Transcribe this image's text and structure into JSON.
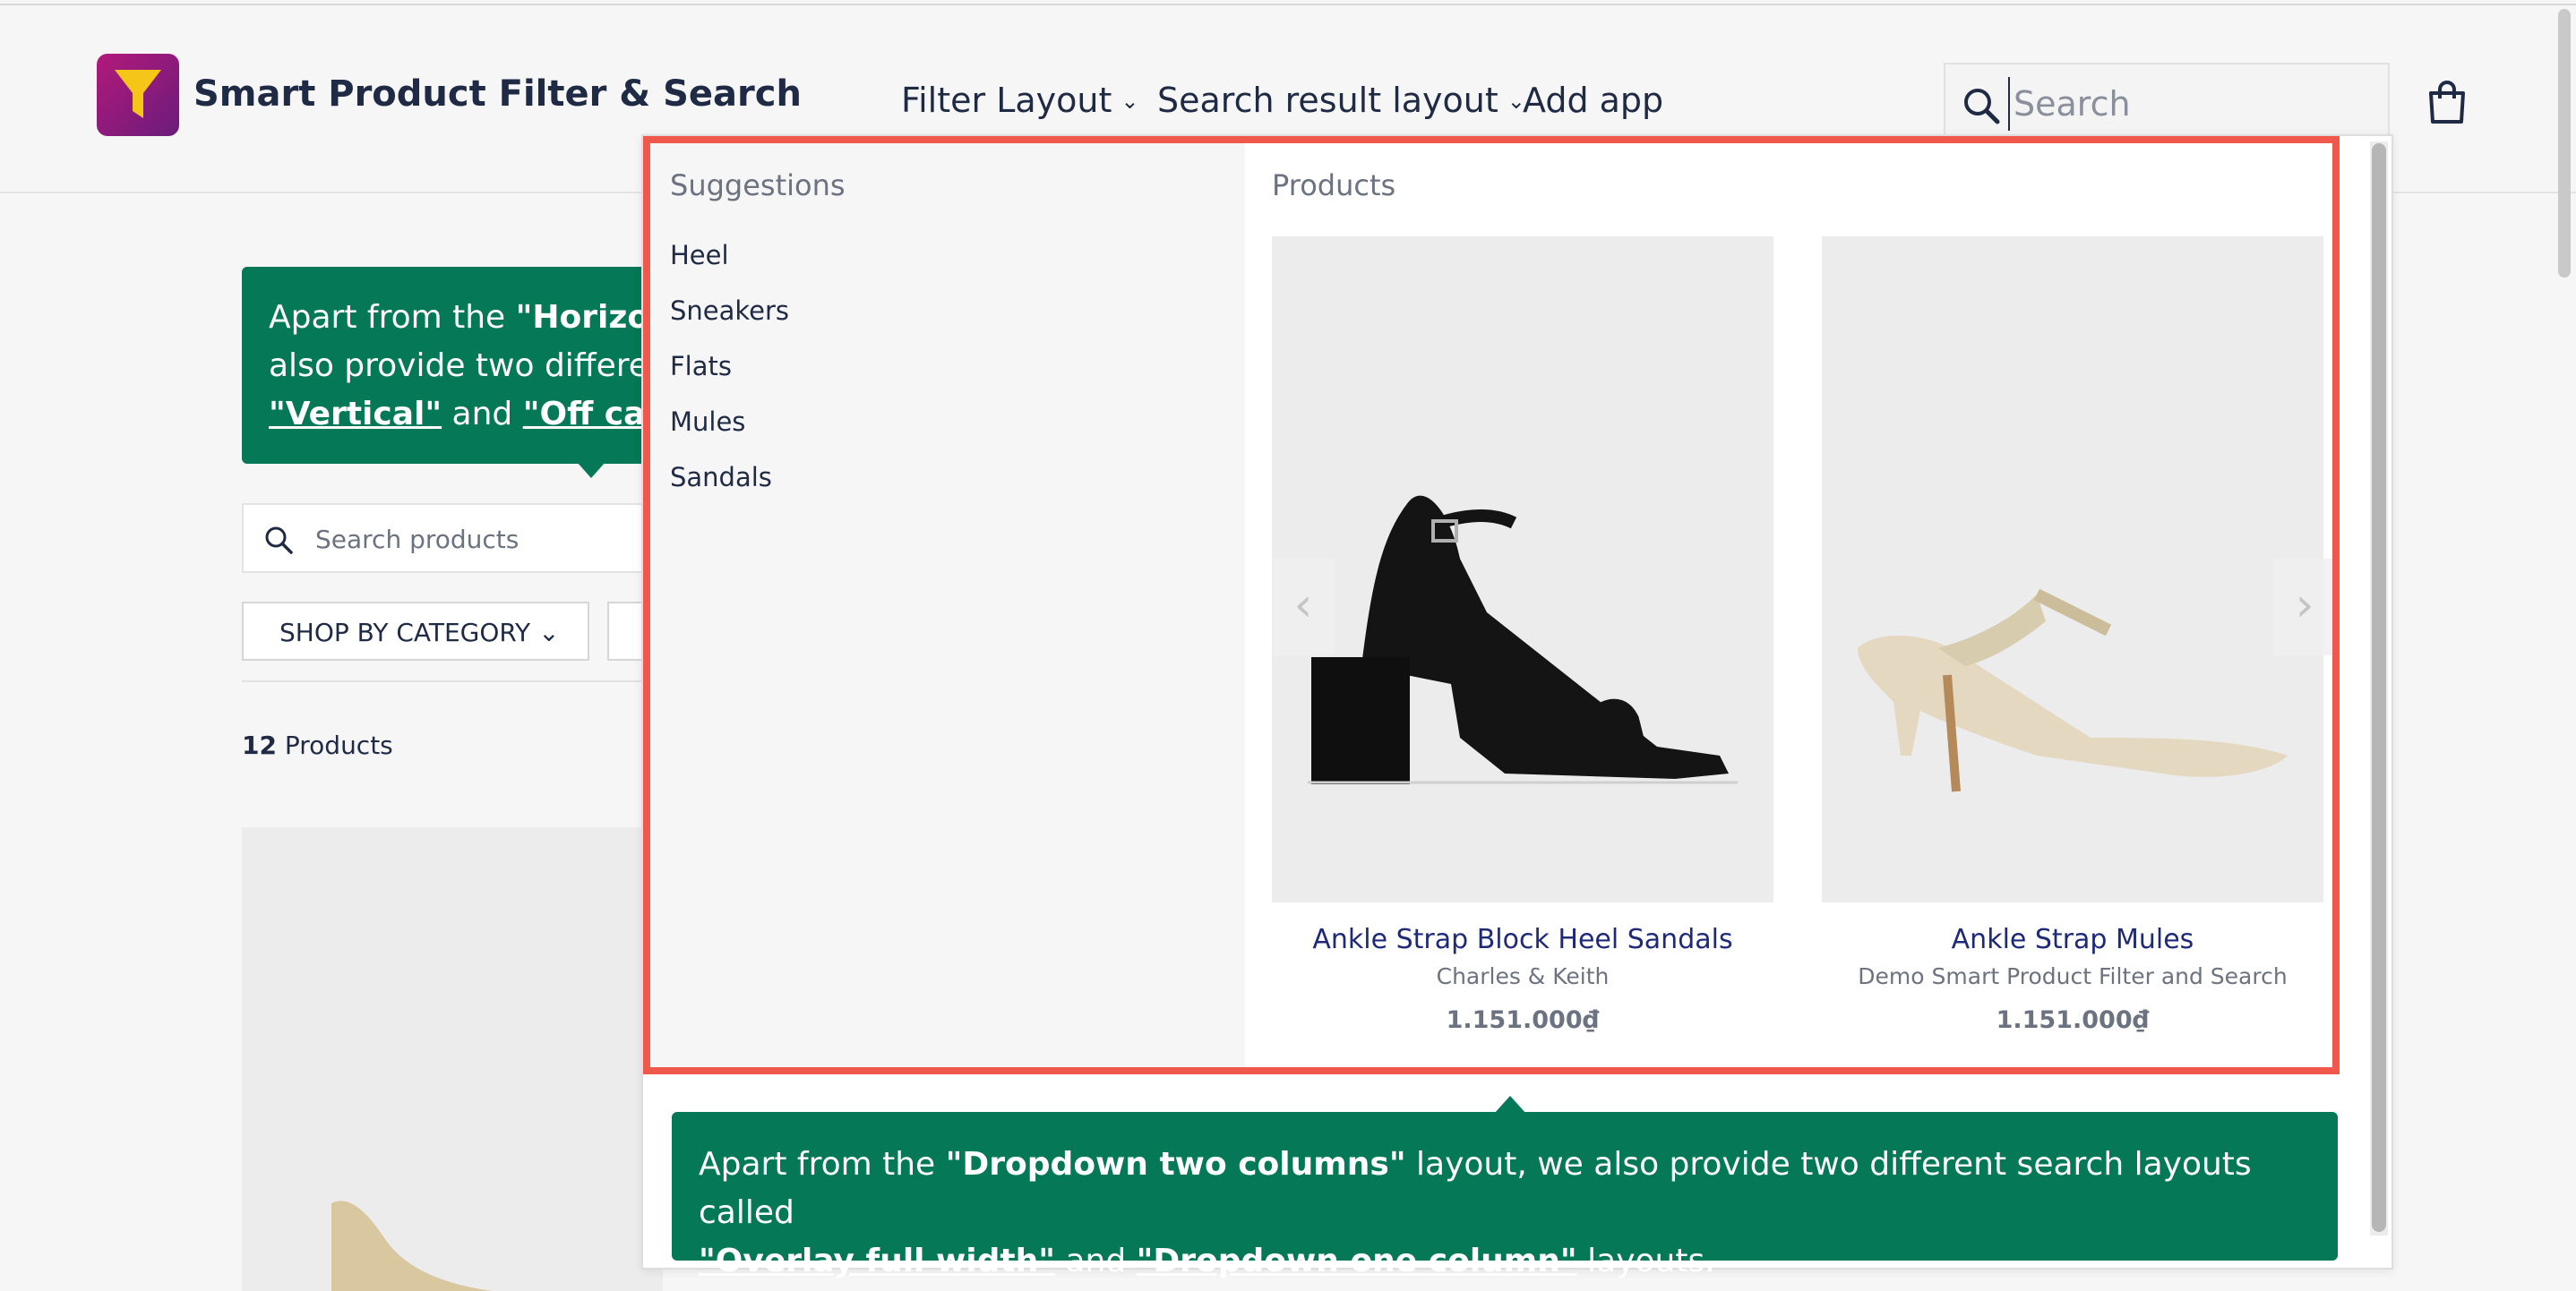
{
  "header": {
    "brand": "Smart Product Filter & Search",
    "nav": [
      {
        "label": "Filter Layout",
        "chevron": "⌄"
      },
      {
        "label": "Search result layout",
        "chevron": "⌄"
      },
      {
        "label": "Add app"
      }
    ],
    "search_placeholder": "Search"
  },
  "background": {
    "tip_prefix": "Apart from the ",
    "tip_bold": "\"Horizont",
    "tip_line2": "also provide two differen",
    "tip_link1": "\"Vertical\"",
    "tip_and": " and ",
    "tip_link2": "\"Off canv",
    "search_products_placeholder": "Search products",
    "category_button": "SHOP BY CATEGORY ⌄",
    "products_count": "12",
    "products_label": " Products"
  },
  "dropdown": {
    "suggestions_title": "Suggestions",
    "suggestions": [
      "Heel",
      "Sneakers",
      "Flats",
      "Mules",
      "Sandals"
    ],
    "products_title": "Products",
    "products": [
      {
        "name": "Ankle Strap Block Heel Sandals",
        "vendor": "Charles & Keith",
        "price": "1.151.000₫"
      },
      {
        "name": "Ankle Strap Mules",
        "vendor": "Demo Smart Product Filter and Search",
        "price": "1.151.000₫"
      }
    ],
    "prev_arrow": "‹",
    "next_arrow": "›"
  },
  "bottom_tip": {
    "prefix": "Apart from the ",
    "bold": "\"Dropdown two columns\"",
    "mid": " layout, we also provide two different search layouts called",
    "link1": "\"Overlay full width\"",
    "and": " and ",
    "link2": "\"Dropdown one column\"",
    "suffix": " layouts."
  },
  "colors": {
    "brand_gradient_start": "#b3197a",
    "brand_gradient_end": "#6a1c7c",
    "logo_funnel": "#f5c518",
    "tip_green": "#047857",
    "highlight_red": "#f0584b",
    "navy_text": "#1f2a44",
    "product_link": "#1e2a78"
  }
}
